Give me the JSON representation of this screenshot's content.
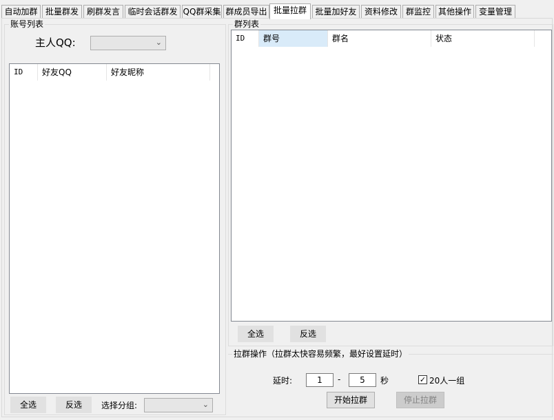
{
  "tabs": [
    {
      "label": "自动加群"
    },
    {
      "label": "批量群发"
    },
    {
      "label": "刷群发言"
    },
    {
      "label": "临时会话群发"
    },
    {
      "label": "QQ群采集"
    },
    {
      "label": "群成员导出"
    },
    {
      "label": "批量拉群",
      "active": true
    },
    {
      "label": "批量加好友"
    },
    {
      "label": "资料修改"
    },
    {
      "label": "群监控"
    },
    {
      "label": "其他操作"
    },
    {
      "label": "变量管理"
    }
  ],
  "account_panel": {
    "title": "账号列表",
    "owner_qq_label": "主人QQ:",
    "owner_qq_value": "",
    "columns": [
      "ID",
      "好友QQ",
      "好友昵称"
    ],
    "select_all": "全选",
    "invert": "反选",
    "group_label": "选择分组:",
    "group_value": ""
  },
  "group_panel": {
    "title": "群列表",
    "columns": [
      "ID",
      "群号",
      "群名",
      "状态"
    ],
    "select_all": "全选",
    "invert": "反选"
  },
  "pull_panel": {
    "title": "拉群操作（拉群太快容易频繁，最好设置延时）",
    "delay_label": "延时:",
    "delay_min": "1",
    "dash": "-",
    "delay_max": "5",
    "unit": "秒",
    "group20_checked": true,
    "group20_label": "20人一组",
    "start": "开始拉群",
    "stop": "停止拉群"
  },
  "icons": {
    "dropdown": "chevron-down-icon",
    "check": "checkmark-icon"
  }
}
